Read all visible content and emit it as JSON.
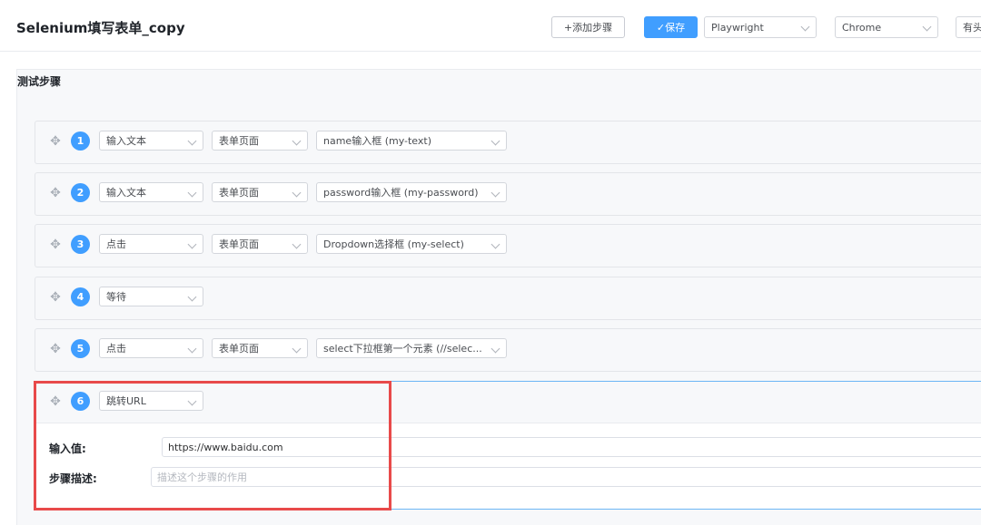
{
  "header": {
    "title": "Selenium填写表单_copy",
    "add_step_label": "+添加步骤",
    "save_label": "✓保存",
    "framework": "Playwright",
    "browser": "Chrome",
    "head_mode": "有头"
  },
  "section": {
    "title": "测试步骤"
  },
  "steps": [
    {
      "num": "1",
      "action": "输入文本",
      "page": "表单页面",
      "element": "name输入框 (my-text)"
    },
    {
      "num": "2",
      "action": "输入文本",
      "page": "表单页面",
      "element": "password输入框 (my-password)"
    },
    {
      "num": "3",
      "action": "点击",
      "page": "表单页面",
      "element": "Dropdown选择框 (my-select)"
    },
    {
      "num": "4",
      "action": "等待"
    },
    {
      "num": "5",
      "action": "点击",
      "page": "表单页面",
      "element": "select下拉框第一个元素 (//selec..."
    },
    {
      "num": "6",
      "action": "跳转URL",
      "input_label": "输入值:",
      "input_value": "https://www.baidu.com",
      "desc_label": "步骤描述:",
      "desc_placeholder": "描述这个步骤的作用"
    }
  ],
  "colors": {
    "accent": "#409eff",
    "highlight": "#e84a4a"
  },
  "icons": {
    "drag": "drag-move-icon",
    "chevron": "chevron-down-icon"
  }
}
